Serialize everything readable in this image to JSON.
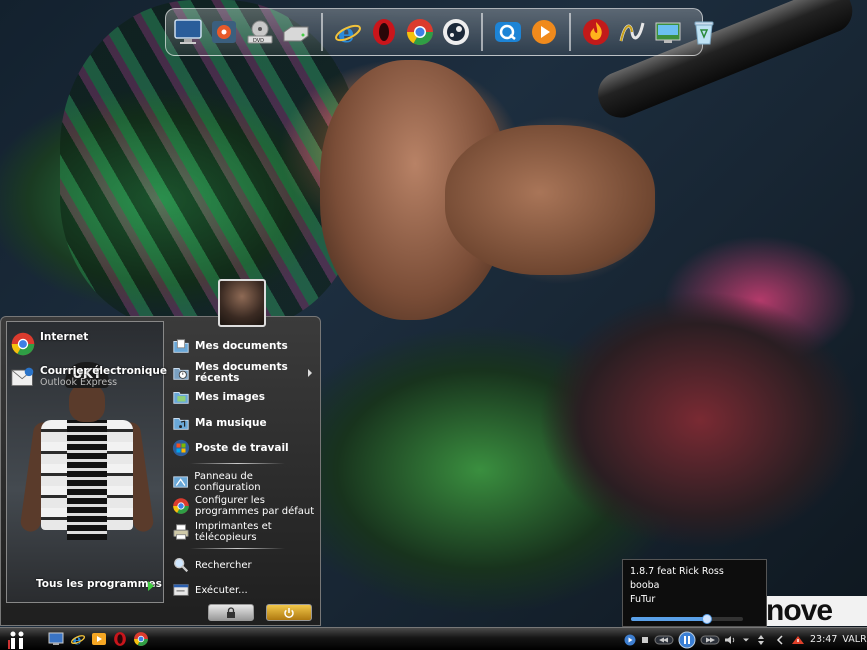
{
  "dock": {
    "icons": [
      "monitor-icon",
      "media-center-icon",
      "dvd-drive-icon",
      "hard-drive-icon",
      "internet-explorer-icon",
      "opera-icon",
      "chrome-icon",
      "steam-icon",
      "quicktime-icon",
      "media-player-icon",
      "firefox-flame-icon",
      "nvu-icon",
      "desktop-icon",
      "recycle-bin-icon"
    ]
  },
  "start_menu": {
    "pinned": [
      {
        "title": "Internet",
        "subtitle": ""
      },
      {
        "title": "Courrier électronique",
        "subtitle": "Outlook Express"
      }
    ],
    "all_programs": "Tous les programmes",
    "right_items": [
      {
        "label": "Mes documents"
      },
      {
        "label": "Mes documents récents"
      },
      {
        "label": "Mes images"
      },
      {
        "label": "Ma musique"
      },
      {
        "label": "Poste de travail"
      },
      {
        "label": "Panneau de configuration"
      },
      {
        "label": "Configurer les programmes par défaut"
      },
      {
        "label": "Imprimantes et télécopieurs"
      },
      {
        "label": "Rechercher"
      },
      {
        "label": "Exécuter..."
      }
    ],
    "shirt_text": "UKT"
  },
  "media": {
    "track": "1.8.7 feat Rick Ross",
    "artist": "booba",
    "album": "FuTur",
    "progress": 0.68
  },
  "tray": {
    "clock": "23:47",
    "user": "VALR"
  },
  "wallpaper": {
    "logo_text": "nove"
  },
  "colors": {
    "accent": "#5aa0e8",
    "power": "#e0a020",
    "taskbar": "#151515"
  }
}
